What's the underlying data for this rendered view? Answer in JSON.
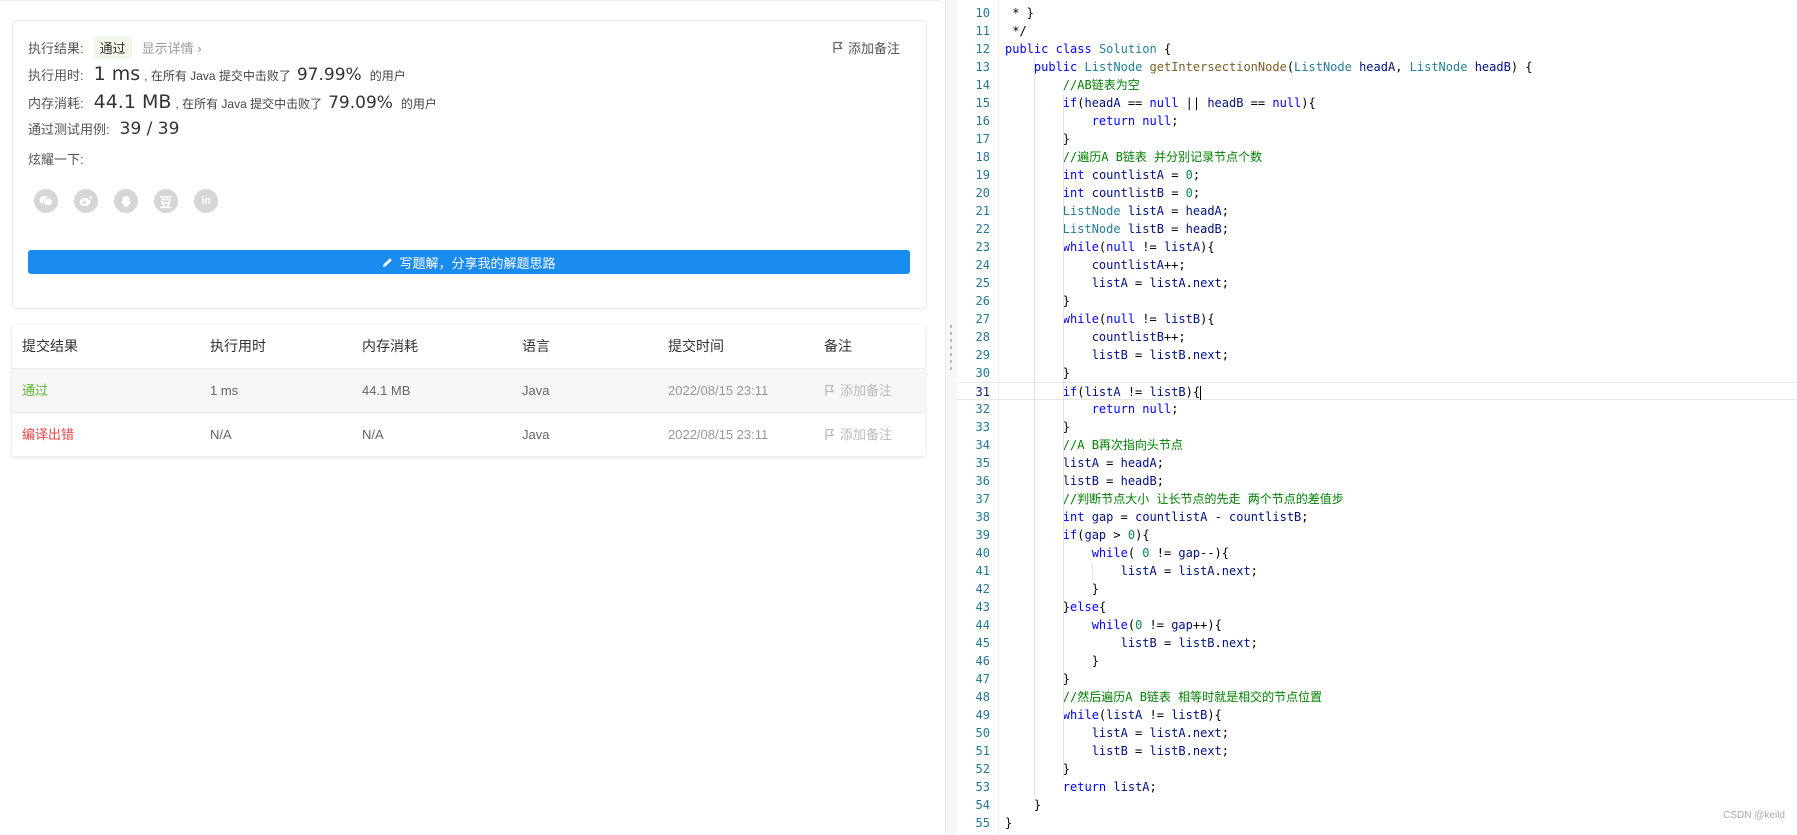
{
  "result": {
    "label": "执行结果:",
    "status": "通过",
    "details_link": "显示详情 ›",
    "add_note": "添加备注",
    "runtime_label": "执行用时:",
    "runtime_value": "1 ms",
    "runtime_text": ", 在所有 Java 提交中击败了",
    "runtime_percent": "97.99%",
    "runtime_suffix": "的用户",
    "memory_label": "内存消耗:",
    "memory_value": "44.1 MB",
    "memory_text": ", 在所有 Java 提交中击败了",
    "memory_percent": "79.09%",
    "memory_suffix": "的用户",
    "tests_label": "通过测试用例:",
    "tests_value": "39 / 39",
    "share_label": "炫耀一下:",
    "share_icons": [
      "wechat-icon",
      "weibo-icon",
      "qq-icon",
      "douban-icon",
      "linkedin-icon"
    ],
    "write_button": "写题解，分享我的解题思路",
    "colors": {
      "accent": "#1a8cf0",
      "pass": "#5cb82e",
      "error": "#e54848"
    }
  },
  "submissions": {
    "headers": [
      "提交结果",
      "执行用时",
      "内存消耗",
      "语言",
      "提交时间",
      "备注"
    ],
    "rows": [
      {
        "status": "通过",
        "runtime": "1 ms",
        "memory": "44.1 MB",
        "language": "Java",
        "time": "2022/08/15 23:11",
        "note": "添加备注"
      },
      {
        "status": "编译出错",
        "runtime": "N/A",
        "memory": "N/A",
        "language": "Java",
        "time": "2022/08/15 23:11",
        "note": "添加备注"
      }
    ]
  },
  "editor": {
    "current_line": 31,
    "lines": [
      {
        "n": "10",
        "src": " * }"
      },
      {
        "n": "11",
        "src": " */"
      },
      {
        "n": "12",
        "src": "public class Solution {"
      },
      {
        "n": "13",
        "src": "    public ListNode getIntersectionNode(ListNode headA, ListNode headB) {"
      },
      {
        "n": "14",
        "src": "        //AB链表为空"
      },
      {
        "n": "15",
        "src": "        if(headA == null || headB == null){"
      },
      {
        "n": "16",
        "src": "            return null;"
      },
      {
        "n": "17",
        "src": "        }"
      },
      {
        "n": "18",
        "src": "        //遍历A B链表 并分别记录节点个数"
      },
      {
        "n": "19",
        "src": "        int countlistA = 0;"
      },
      {
        "n": "20",
        "src": "        int countlistB = 0;"
      },
      {
        "n": "21",
        "src": "        ListNode listA = headA;"
      },
      {
        "n": "22",
        "src": "        ListNode listB = headB;"
      },
      {
        "n": "23",
        "src": "        while(null != listA){"
      },
      {
        "n": "24",
        "src": "            countlistA++;"
      },
      {
        "n": "25",
        "src": "            listA = listA.next;"
      },
      {
        "n": "26",
        "src": "        }"
      },
      {
        "n": "27",
        "src": "        while(null != listB){"
      },
      {
        "n": "28",
        "src": "            countlistB++;"
      },
      {
        "n": "29",
        "src": "            listB = listB.next;"
      },
      {
        "n": "30",
        "src": "        }"
      },
      {
        "n": "31",
        "src": "        if(listA != listB){"
      },
      {
        "n": "32",
        "src": "            return null;"
      },
      {
        "n": "33",
        "src": "        }"
      },
      {
        "n": "34",
        "src": "        //A B再次指向头节点"
      },
      {
        "n": "35",
        "src": "        listA = headA;"
      },
      {
        "n": "36",
        "src": "        listB = headB;"
      },
      {
        "n": "37",
        "src": "        //判断节点大小 让长节点的先走 两个节点的差值步"
      },
      {
        "n": "38",
        "src": "        int gap = countlistA - countlistB;"
      },
      {
        "n": "39",
        "src": "        if(gap > 0){"
      },
      {
        "n": "40",
        "src": "            while( 0 != gap--){"
      },
      {
        "n": "41",
        "src": "                listA = listA.next;"
      },
      {
        "n": "42",
        "src": "            }"
      },
      {
        "n": "43",
        "src": "        }else{"
      },
      {
        "n": "44",
        "src": "            while(0 != gap++){"
      },
      {
        "n": "45",
        "src": "                listB = listB.next;"
      },
      {
        "n": "46",
        "src": "            }"
      },
      {
        "n": "47",
        "src": "        }"
      },
      {
        "n": "48",
        "src": "        //然后遍历A B链表 相等时就是相交的节点位置"
      },
      {
        "n": "49",
        "src": "        while(listA != listB){"
      },
      {
        "n": "50",
        "src": "            listA = listA.next;"
      },
      {
        "n": "51",
        "src": "            listB = listB.next;"
      },
      {
        "n": "52",
        "src": "        }"
      },
      {
        "n": "53",
        "src": "        return listA;"
      },
      {
        "n": "54",
        "src": "    }"
      },
      {
        "n": "55",
        "src": "}"
      }
    ]
  },
  "watermark": "CSDN @keild"
}
